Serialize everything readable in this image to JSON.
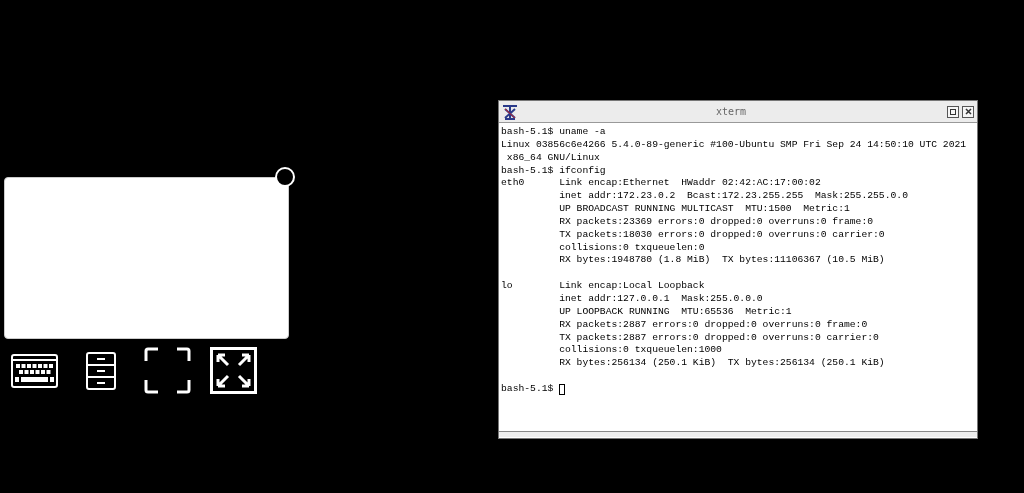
{
  "window": {
    "title": "xterm"
  },
  "terminal": {
    "blocks": [
      [
        "bash-5.1$ uname -a",
        "Linux 03856c6e4266 5.4.0-89-generic #100-Ubuntu SMP Fri Sep 24 14:50:10 UTC 2021",
        " x86_64 GNU/Linux",
        "bash-5.1$ ifconfig",
        "eth0      Link encap:Ethernet  HWaddr 02:42:AC:17:00:02",
        "          inet addr:172.23.0.2  Bcast:172.23.255.255  Mask:255.255.0.0",
        "          UP BROADCAST RUNNING MULTICAST  MTU:1500  Metric:1",
        "          RX packets:23369 errors:0 dropped:0 overruns:0 frame:0",
        "          TX packets:18030 errors:0 dropped:0 overruns:0 carrier:0",
        "          collisions:0 txqueuelen:0",
        "          RX bytes:1948780 (1.8 MiB)  TX bytes:11106367 (10.5 MiB)"
      ],
      [
        "lo        Link encap:Local Loopback",
        "          inet addr:127.0.0.1  Mask:255.0.0.0",
        "          UP LOOPBACK RUNNING  MTU:65536  Metric:1",
        "          RX packets:2887 errors:0 dropped:0 overruns:0 frame:0",
        "          TX packets:2887 errors:0 dropped:0 overruns:0 carrier:0",
        "          collisions:0 txqueuelen:1000",
        "          RX bytes:256134 (250.1 KiB)  TX bytes:256134 (250.1 KiB)"
      ]
    ],
    "prompt": "bash-5.1$"
  }
}
